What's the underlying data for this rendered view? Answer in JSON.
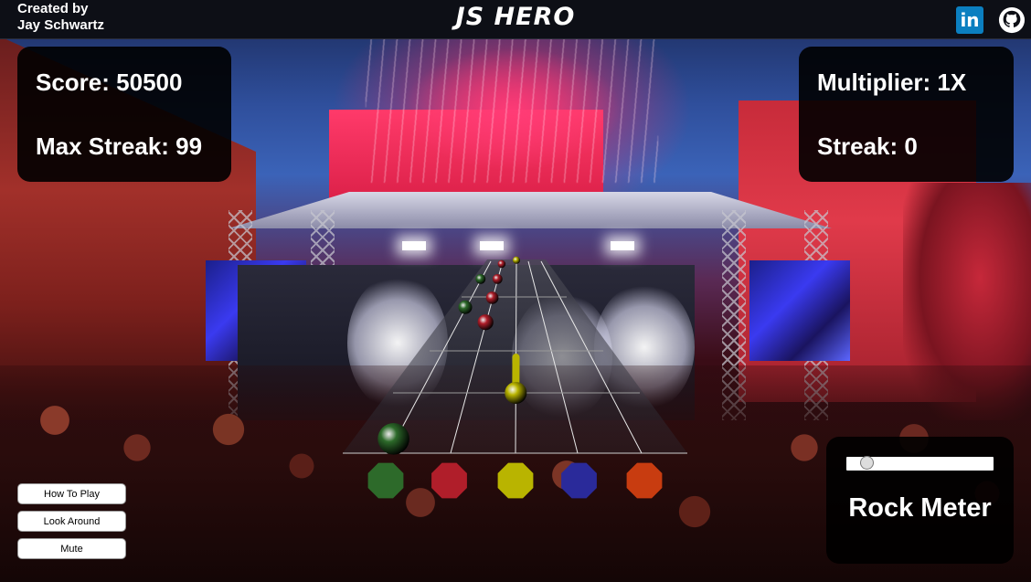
{
  "header": {
    "credit_line1": "Created by",
    "credit_line2": "Jay Schwartz",
    "title": "JS HERO",
    "linkedin_icon": "linkedin-icon",
    "linkedin_text": "in",
    "github_icon": "github-icon"
  },
  "stats_left": {
    "score": "Score: 50500",
    "max_streak": "Max Streak: 99"
  },
  "stats_right": {
    "multiplier": "Multiplier: 1X",
    "streak": "Streak: 0"
  },
  "buttons": {
    "how_to_play": "How To Play",
    "look_around": "Look Around",
    "mute": "Mute"
  },
  "rock_meter": {
    "label": "Rock Meter",
    "level": 0.1
  },
  "colors": {
    "green": "#2d6a2a",
    "red": "#b01e2a",
    "yellow": "#b9b400",
    "blue": "#2a2a9a",
    "orange": "#c83c10",
    "highway": "#b9b9b9"
  },
  "frets": [
    "green",
    "red",
    "yellow",
    "blue",
    "orange"
  ],
  "notes": [
    {
      "lane": "green",
      "progress": 0.1
    },
    {
      "lane": "green",
      "progress": 0.25
    },
    {
      "lane": "green",
      "progress": 0.95
    },
    {
      "lane": "red",
      "progress": 0.02
    },
    {
      "lane": "red",
      "progress": 0.1
    },
    {
      "lane": "red",
      "progress": 0.2
    },
    {
      "lane": "red",
      "progress": 0.33
    },
    {
      "lane": "yellow",
      "progress": 0.0
    }
  ],
  "sustain": {
    "lane": "yellow",
    "from": 0.5,
    "to": 0.7
  }
}
